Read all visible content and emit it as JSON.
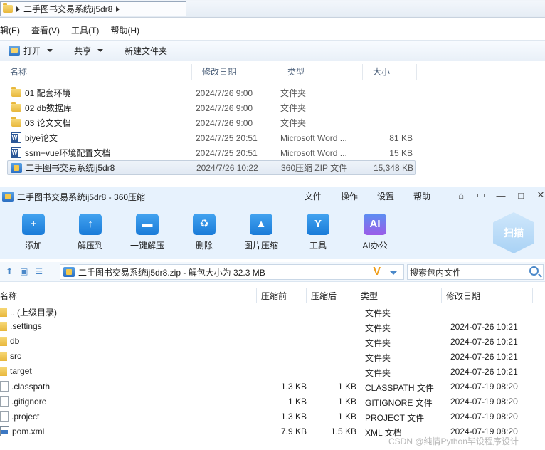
{
  "explorer": {
    "address_path": "二手图书交易系统ij5dr8",
    "menu": [
      "辑(E)",
      "查看(V)",
      "工具(T)",
      "帮助(H)"
    ],
    "toolbar": {
      "open": "打开",
      "share": "共享",
      "new_folder": "新建文件夹"
    },
    "columns": {
      "name": "名称",
      "date": "修改日期",
      "type": "类型",
      "size": "大小"
    },
    "files": [
      {
        "name": "01 配套环境",
        "date": "2024/7/26 9:00",
        "type": "文件夹",
        "size": "",
        "icon": "folder-icon"
      },
      {
        "name": "02 db数据库",
        "date": "2024/7/26 9:00",
        "type": "文件夹",
        "size": "",
        "icon": "folder-icon"
      },
      {
        "name": "03 论文文档",
        "date": "2024/7/26 9:00",
        "type": "文件夹",
        "size": "",
        "icon": "folder-icon"
      },
      {
        "name": "biye论文",
        "date": "2024/7/25 20:51",
        "type": "Microsoft Word ...",
        "size": "81 KB",
        "icon": "word-doc-icon"
      },
      {
        "name": "ssm+vue环境配置文档",
        "date": "2024/7/25 20:51",
        "type": "Microsoft Word ...",
        "size": "15 KB",
        "icon": "word-doc-icon"
      },
      {
        "name": "二手图书交易系统ij5dr8",
        "date": "2024/7/26 10:22",
        "type": "360压缩 ZIP 文件",
        "size": "15,348 KB",
        "icon": "zip-icon"
      }
    ]
  },
  "zip": {
    "title": "二手图书交易系统ij5dr8 - 360压缩",
    "menu": [
      "文件",
      "操作",
      "设置",
      "帮助"
    ],
    "tools": [
      {
        "label": "添加",
        "glyph": "+"
      },
      {
        "label": "解压到",
        "glyph": "↑"
      },
      {
        "label": "一键解压",
        "glyph": "▬"
      },
      {
        "label": "删除",
        "glyph": "♻"
      },
      {
        "label": "图片压缩",
        "glyph": "▲"
      },
      {
        "label": "工具",
        "glyph": "Y"
      },
      {
        "label": "AI办公",
        "glyph": "AI"
      }
    ],
    "scan_label": "扫描",
    "path_text": "二手图书交易系统ij5dr8.zip - 解包大小为 32.3 MB",
    "search_placeholder": "搜索包内文件",
    "columns": {
      "name": "名称",
      "packed": "压缩前",
      "compressed": "压缩后",
      "type": "类型",
      "date": "修改日期"
    },
    "entries": [
      {
        "name": ".. (上级目录)",
        "before": "",
        "after": "",
        "type": "文件夹",
        "date": "",
        "icon": "folder-icon"
      },
      {
        "name": ".settings",
        "before": "",
        "after": "",
        "type": "文件夹",
        "date": "2024-07-26 10:21",
        "icon": "folder-icon"
      },
      {
        "name": "db",
        "before": "",
        "after": "",
        "type": "文件夹",
        "date": "2024-07-26 10:21",
        "icon": "folder-icon"
      },
      {
        "name": "src",
        "before": "",
        "after": "",
        "type": "文件夹",
        "date": "2024-07-26 10:21",
        "icon": "folder-icon"
      },
      {
        "name": "target",
        "before": "",
        "after": "",
        "type": "文件夹",
        "date": "2024-07-26 10:21",
        "icon": "folder-icon"
      },
      {
        "name": ".classpath",
        "before": "1.3 KB",
        "after": "1 KB",
        "type": "CLASSPATH 文件",
        "date": "2024-07-19 08:20",
        "icon": "file-icon"
      },
      {
        "name": ".gitignore",
        "before": "1 KB",
        "after": "1 KB",
        "type": "GITIGNORE 文件",
        "date": "2024-07-19 08:20",
        "icon": "file-icon"
      },
      {
        "name": ".project",
        "before": "1.3 KB",
        "after": "1 KB",
        "type": "PROJECT 文件",
        "date": "2024-07-19 08:20",
        "icon": "file-icon"
      },
      {
        "name": "pom.xml",
        "before": "7.9 KB",
        "after": "1.5 KB",
        "type": "XML 文档",
        "date": "2024-07-19 08:20",
        "icon": "xml-file-icon"
      }
    ]
  },
  "watermark": "CSDN @纯情Python毕设程序设计"
}
